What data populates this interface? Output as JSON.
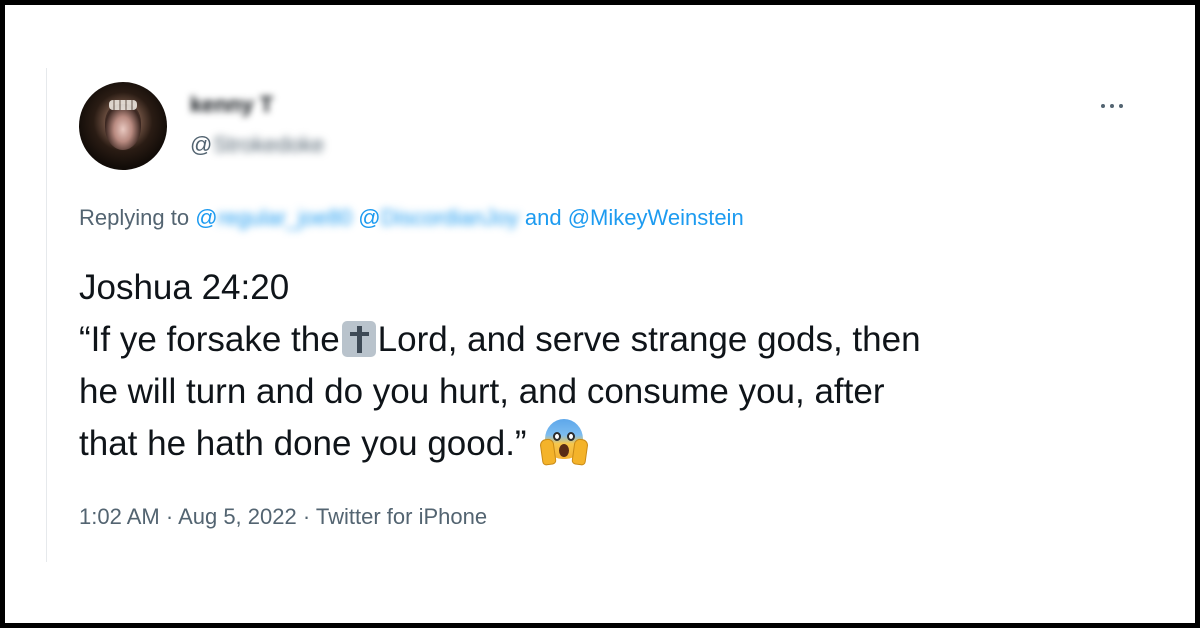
{
  "tweet": {
    "author": {
      "display_name": "kenny T",
      "handle_prefix": "@",
      "handle": "Strokedoke",
      "avatar": "dog-avatar"
    },
    "more_icon": "more-horizontal-icon",
    "replying": {
      "label": "Replying to",
      "mention_1": "@regular_joe80",
      "mention_2": "@DiscordianJoy",
      "conjunction": "and",
      "mention_3": "@MikeyWeinstein"
    },
    "body": {
      "line1": "Joshua 24:20",
      "line2_before": "“If ye forsake the",
      "line2_emoji": "latin-cross-emoji",
      "line2_after": "Lord, and serve strange gods, then",
      "line3": "he will turn and do you hurt, and consume you, after",
      "line4": "that he hath done you good.”",
      "line4_emoji": "face-screaming-in-fear-emoji"
    },
    "meta": {
      "time": "1:02 AM",
      "separator": " · ",
      "date": "Aug 5, 2022",
      "source": "Twitter for iPhone"
    }
  },
  "colors": {
    "text_primary": "#0f1419",
    "text_secondary": "#536471",
    "link": "#1d9bf0",
    "frame_border": "#000000"
  }
}
